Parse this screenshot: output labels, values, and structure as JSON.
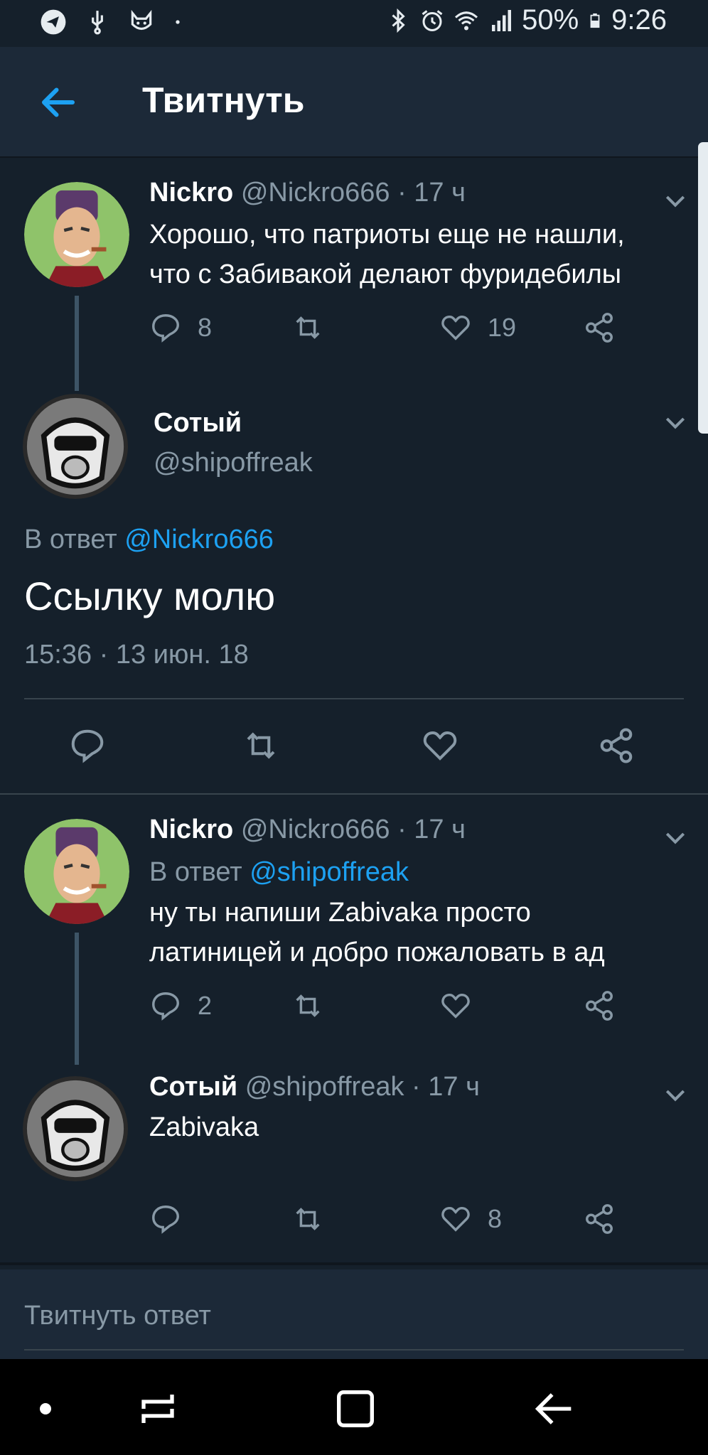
{
  "status_bar": {
    "battery": "50%",
    "time": "9:26",
    "left_icons": [
      "telegram-icon",
      "usb-icon",
      "fox-icon",
      "dot-icon"
    ],
    "right_icons": [
      "bluetooth-icon",
      "alarm-icon",
      "wifi-icon",
      "signal-icon",
      "battery-icon"
    ]
  },
  "header": {
    "title": "Твитнуть"
  },
  "tweets": [
    {
      "name": "Nickro",
      "handle": "@Nickro666",
      "time": "· 17 ч",
      "text_lines": [
        "Хорошо, что патриоты еще не нашли,",
        "что с Забивакой делают фуридебилы"
      ],
      "replies": "8",
      "likes": "19"
    },
    {
      "name": "Сотый",
      "handle": "@shipoffreak",
      "reply_prefix": "В ответ",
      "reply_to": "@Nickro666",
      "text": "Ссылку молю",
      "timestamp": "15:36 · 13 июн. 18"
    },
    {
      "name": "Nickro",
      "handle": "@Nickro666",
      "time": "· 17 ч",
      "reply_prefix": "В ответ",
      "reply_to": "@shipoffreak",
      "text_lines": [
        "ну ты напиши Zabivaka просто",
        "латиницей и добро пожаловать в ад"
      ],
      "replies": "2"
    },
    {
      "name": "Сотый",
      "handle": "@shipoffreak",
      "time": "· 17 ч",
      "text": "Zabivaka",
      "likes": "8"
    }
  ],
  "composer": {
    "placeholder": "Твитнуть ответ"
  },
  "colors": {
    "background": "#15202b",
    "header": "#1c2938",
    "link": "#1da1f2",
    "muted": "#8899a6"
  }
}
